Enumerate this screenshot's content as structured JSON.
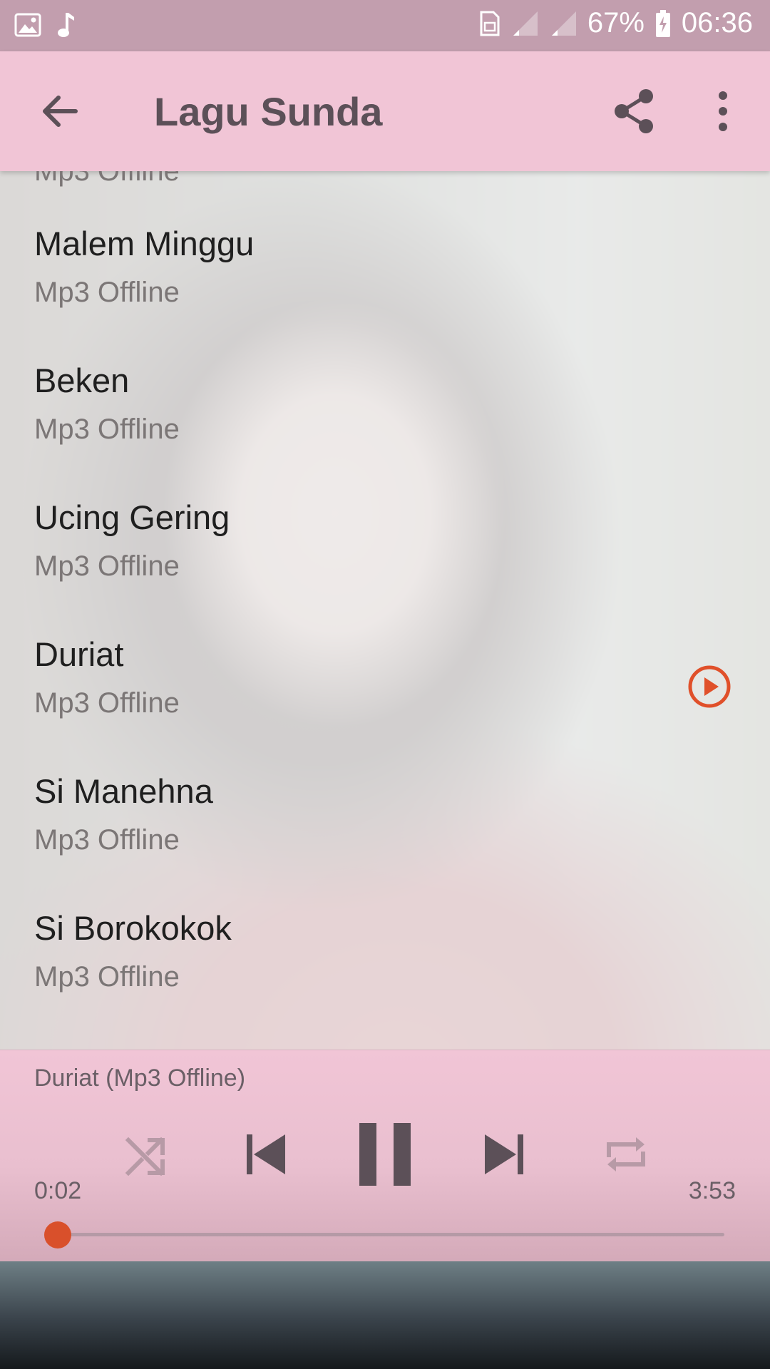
{
  "status_bar": {
    "battery": "67%",
    "time": "06:36"
  },
  "app_bar": {
    "title": "Lagu Sunda"
  },
  "list": {
    "partial_subtitle": "Mp3 Offline",
    "items": [
      {
        "title": "Malem Minggu",
        "subtitle": "Mp3 Offline"
      },
      {
        "title": "Beken",
        "subtitle": "Mp3 Offline"
      },
      {
        "title": "Ucing Gering",
        "subtitle": "Mp3 Offline"
      },
      {
        "title": "Duriat",
        "subtitle": "Mp3 Offline",
        "playing": true
      },
      {
        "title": "Si Manehna",
        "subtitle": "Mp3 Offline"
      },
      {
        "title": "Si Borokokok",
        "subtitle": "Mp3 Offline"
      }
    ]
  },
  "player": {
    "now_playing": "Duriat (Mp3 Offline)",
    "elapsed": "0:02",
    "duration": "3:53",
    "progress_fraction": 0.01
  },
  "colors": {
    "status_bar": "#c29eae",
    "app_bar": "#f1c5d6",
    "accent": "#e0502a",
    "icon": "#5c5058"
  },
  "icons": {
    "back": "arrow-left-icon",
    "share": "share-icon",
    "menu": "more-vert-icon",
    "playing": "play-circle-icon",
    "shuffle": "shuffle-icon",
    "previous": "skip-previous-icon",
    "pause": "pause-icon",
    "next": "skip-next-icon",
    "repeat": "repeat-icon"
  }
}
